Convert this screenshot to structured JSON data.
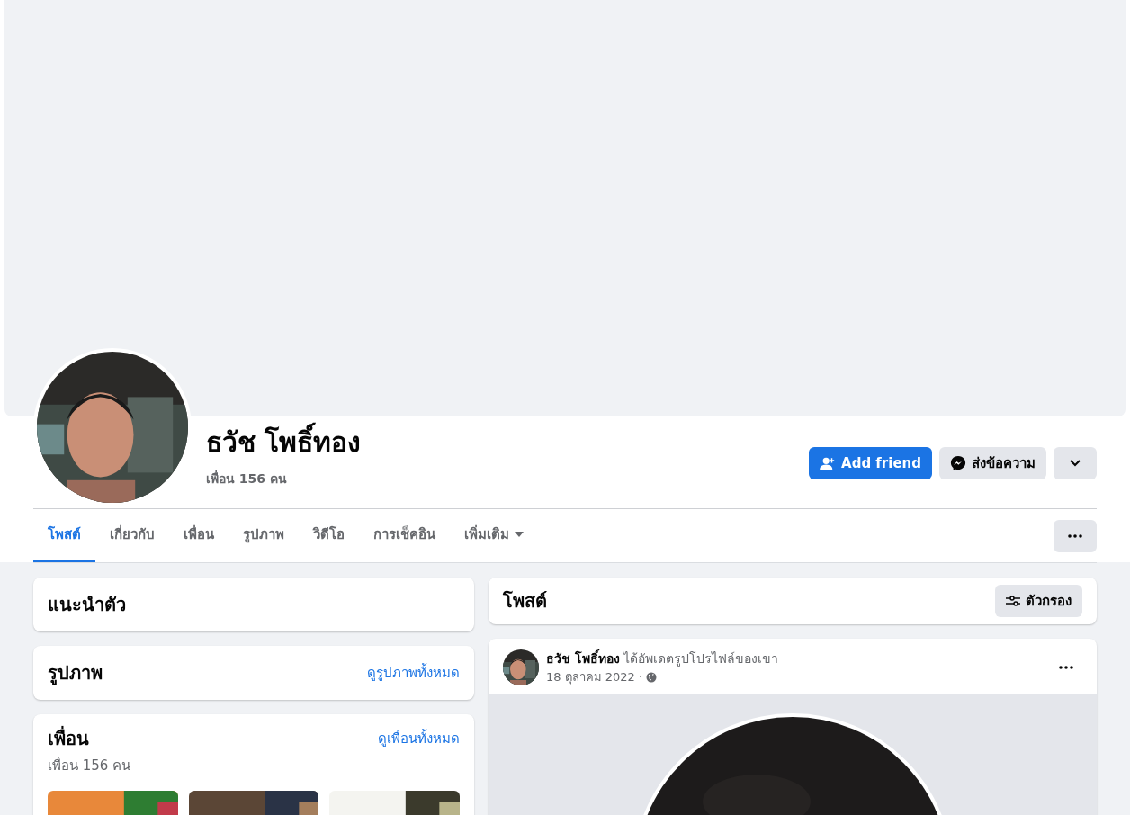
{
  "profile": {
    "name": "ธวัช โพธิ์ทอง",
    "friend_count": "เพื่อน 156 คน"
  },
  "actions": [
    {
      "kind": "add",
      "label": "Add friend"
    },
    {
      "kind": "message",
      "label": "ส่งข้อความ"
    },
    {
      "kind": "expand"
    }
  ],
  "tabs": [
    {
      "label": "โพสต์",
      "selected": true
    },
    {
      "label": "เกี่ยวกับ",
      "selected": false
    },
    {
      "label": "เพื่อน",
      "selected": false
    },
    {
      "label": "รูปภาพ",
      "selected": false
    },
    {
      "label": "วิดีโอ",
      "selected": false
    },
    {
      "label": "การเช็คอิน",
      "selected": false
    },
    {
      "label": "เพิ่มเติม",
      "selected": false,
      "kind": "dropdown"
    }
  ],
  "intro": {
    "title": "แนะนำตัว"
  },
  "photos": {
    "title": "รูปภาพ",
    "link": "ดูรูปภาพทั้งหมด"
  },
  "friends": {
    "title": "เพื่อน",
    "link": "ดูเพื่อนทั้งหมด",
    "count": "เพื่อน 156 คน"
  },
  "posts_header": {
    "title": "โพสต์",
    "filter": "ตัวกรอง"
  },
  "post": {
    "headline": "**ธวัช โพธิ์ทอง** ได้อัพเดตรูปโปรไฟล์ของเขา",
    "date": "18 ตุลาคม 2022 ·"
  }
}
